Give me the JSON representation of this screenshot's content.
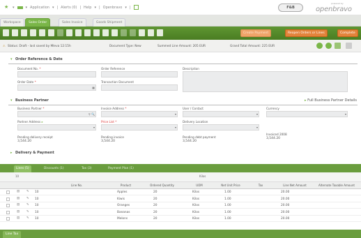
{
  "topbar": {
    "nav_items": [
      "Application",
      "Alerts (0)",
      "Help",
      "Openbravo"
    ],
    "user_label": "F&B",
    "logo_text": "openbravo",
    "powered_by": "powered by"
  },
  "tabs": [
    {
      "label": "Workspace",
      "active": false
    },
    {
      "label": "Sales Order",
      "active": true
    },
    {
      "label": "Sales Invoice",
      "active": false
    },
    {
      "label": "Goods Shipment",
      "active": false
    }
  ],
  "toolbar": {
    "icons": [
      "new-icon",
      "save-icon",
      "undo-icon",
      "delete-icon",
      "grid-icon",
      "print-icon",
      "email-icon",
      "attach-icon",
      "link-icon",
      "export-icon",
      "sum-icon",
      "report-icon",
      "audit-icon",
      "notes-icon",
      "info-icon",
      "tree-icon",
      "star-icon",
      "refresh-icon"
    ],
    "buttons": [
      {
        "label": "Create Payment",
        "disabled": true
      },
      {
        "label": "Reopen Orders or Lines",
        "disabled": false
      },
      {
        "label": "Complete",
        "disabled": false
      }
    ]
  },
  "status": {
    "doc_status": "Status: Draft - last saved by Mleva 12:15h",
    "document_type": "Document Type: New",
    "summed_line_amount": "Summed Line Amount: 205 EUR",
    "grand_total": "Grand Total Amount: 225 EUR"
  },
  "section_order": {
    "title": "Order Reference & Date",
    "document_no_label": "Document No.",
    "order_reference_label": "Order Reference",
    "description_label": "Description",
    "order_date_label": "Order Date",
    "transaction_document_label": "Transaction Document"
  },
  "section_bp": {
    "title": "Business Partner",
    "full_link": "Full Business Partner Details",
    "business_partner_label": "Business Partner",
    "invoice_address_label": "Invoice Address",
    "user_contact_label": "User / Contact",
    "currency_label": "Currency",
    "partner_address_label": "Partner Address",
    "price_list_label": "Price List",
    "delivery_location_label": "Delivery Location",
    "pending_delivery_label": "Pending delivery receipt",
    "pending_delivery_value": "3,544.20",
    "pending_invoice_label": "Pending invoice",
    "pending_invoice_value": "3,544.20",
    "pending_debt_label": "Pending debt payment",
    "pending_debt_value": "3,544.20",
    "invoiced_label": "Invoiced 2008",
    "invoiced_value": "3,544.20"
  },
  "section_delivery": {
    "title": "Delivery & Payment"
  },
  "bottom_tabs": [
    {
      "label": "Lines (5)",
      "active": true
    },
    {
      "label": "Discounts (1)",
      "active": false
    },
    {
      "label": "Tax (3)",
      "active": false
    },
    {
      "label": "Payment Plan (1)",
      "active": false
    }
  ],
  "grid": {
    "count": "10",
    "uom_filter": "Kilos",
    "columns": [
      "Line No.",
      "Product",
      "Ordered Quantity",
      "UOM",
      "Net Unit Price",
      "Tax",
      "Line Net Amount",
      "Alternate Taxable Amount"
    ],
    "rows": [
      {
        "line": "10",
        "product": "Apples",
        "qty": "20",
        "uom": "Kilos",
        "price": "1.00",
        "tax": "",
        "net": "20.00"
      },
      {
        "line": "10",
        "product": "Kiwis",
        "qty": "20",
        "uom": "Kilos",
        "price": "1.00",
        "tax": "",
        "net": "20.00"
      },
      {
        "line": "10",
        "product": "Oranges",
        "qty": "20",
        "uom": "Kilos",
        "price": "1.00",
        "tax": "",
        "net": "20.00"
      },
      {
        "line": "10",
        "product": "Bananas",
        "qty": "20",
        "uom": "Kilos",
        "price": "1.00",
        "tax": "",
        "net": "20.00"
      },
      {
        "line": "10",
        "product": "Melons",
        "qty": "20",
        "uom": "Kilos",
        "price": "1.00",
        "tax": "",
        "net": "20.00"
      }
    ]
  },
  "footer": {
    "tab_label": "Line Tax"
  },
  "colors": {
    "accent_green": "#7ab648",
    "toolbar_green": "#5f9632",
    "button_orange": "#e3833b"
  }
}
